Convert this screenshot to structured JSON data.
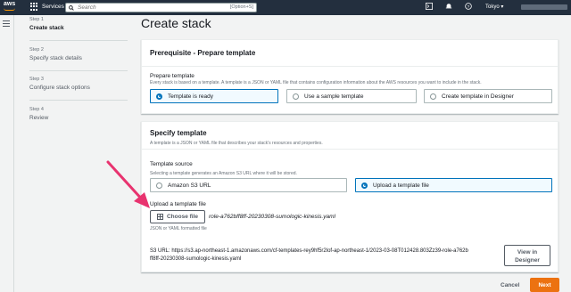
{
  "nav": {
    "logo": "aws",
    "services": "Services",
    "search_placeholder": "Search",
    "search_shortcut": "[Option+S]",
    "region": "Tokyo ▾"
  },
  "steps": [
    {
      "num": "Step 1",
      "label": "Create stack"
    },
    {
      "num": "Step 2",
      "label": "Specify stack details"
    },
    {
      "num": "Step 3",
      "label": "Configure stack options"
    },
    {
      "num": "Step 4",
      "label": "Review"
    }
  ],
  "page_title": "Create stack",
  "prerequisite": {
    "title": "Prerequisite - Prepare template",
    "field_label": "Prepare template",
    "field_desc": "Every stack is based on a template. A template is a JSON or YAML file that contains configuration information about the AWS resources you want to include in the stack.",
    "options": [
      "Template is ready",
      "Use a sample template",
      "Create template in Designer"
    ]
  },
  "specify": {
    "title": "Specify template",
    "desc": "A template is a JSON or YAML file that describes your stack's resources and properties.",
    "source_label": "Template source",
    "source_desc": "Selecting a template generates an Amazon S3 URL where it will be stored.",
    "source_options": [
      "Amazon S3 URL",
      "Upload a template file"
    ],
    "upload_label": "Upload a template file",
    "choose_file": "Choose file",
    "file_name": "role-a762bff8ff-20230308-sumologic-kinesis.yaml",
    "constraint": "JSON or YAML formatted file",
    "s3_url_line1": "S3 URL:   https://s3.ap-northeast-1.amazonaws.com/cf-templates-rey9hf5r2lof-ap-northeast-1/2023-03-08T012428.803Zz39-role-a762b",
    "s3_url_line2": "ff8ff-20230308-sumologic-kinesis.yaml",
    "view_designer_1": "View in",
    "view_designer_2": "Designer"
  },
  "footer": {
    "cancel": "Cancel",
    "next": "Next"
  },
  "colors": {
    "nav_bg": "#232f3e",
    "accent": "#0073bb",
    "primary_button": "#ec7211",
    "annotation_arrow": "#e8336f"
  }
}
